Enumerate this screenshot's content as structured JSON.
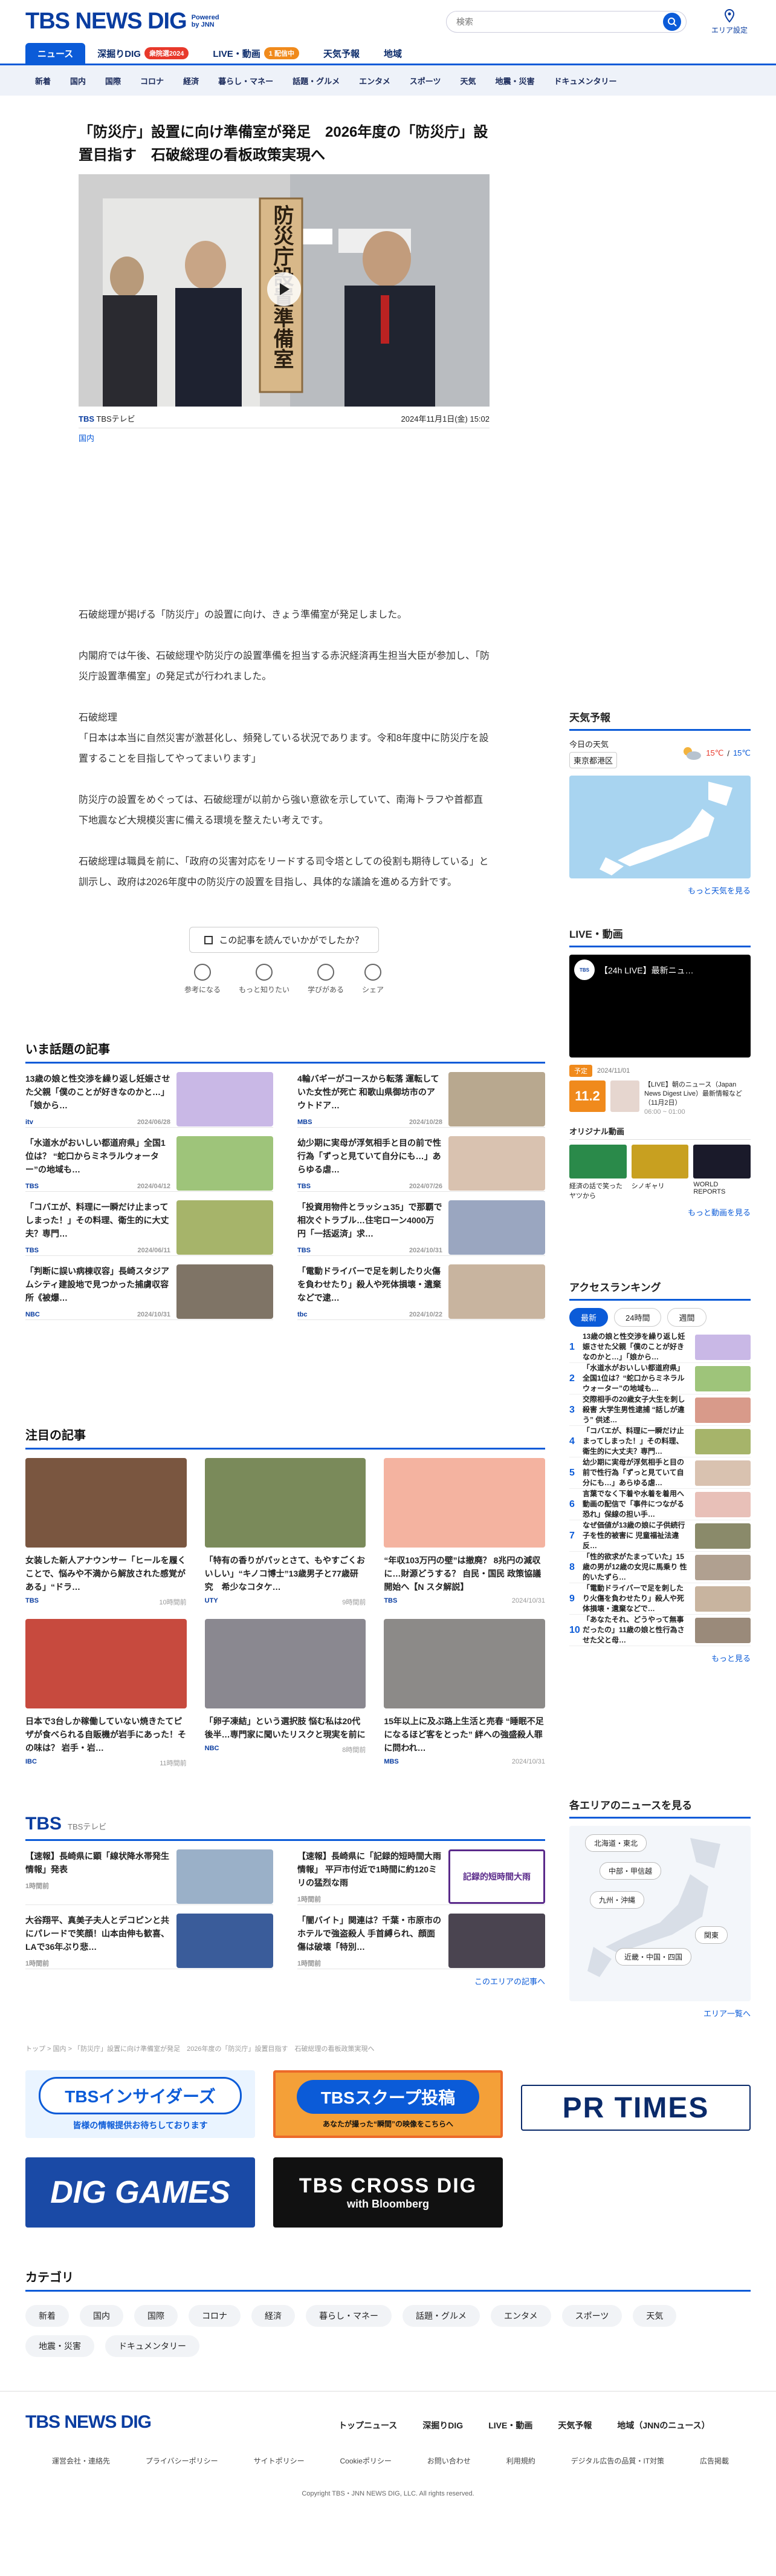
{
  "header": {
    "logo": "TBS NEWS DIG",
    "powered": "Powered by JNN",
    "search_placeholder": "検索",
    "area_label": "エリア設定"
  },
  "nav_main": [
    {
      "label": "ニュース"
    },
    {
      "label": "深掘りDIG",
      "badge": "衆院選2024",
      "badge_color": "#e8392b"
    },
    {
      "label": "LIVE・動画",
      "badge": "1 配信中",
      "badge_color": "#f08a1c"
    },
    {
      "label": "天気予報"
    },
    {
      "label": "地域"
    }
  ],
  "nav_sub": [
    "新着",
    "国内",
    "国際",
    "コロナ",
    "経済",
    "暮らし・マネー",
    "話題・グルメ",
    "エンタメ",
    "スポーツ",
    "天気",
    "地震・災害",
    "ドキュメンタリー"
  ],
  "article": {
    "title": "「防災庁」設置に向け準備室が発足　2026年度の「防災庁」設置目指す　石破総理の看板政策実現へ",
    "source": "TBSテレビ",
    "datetime": "2024年11月1日(金) 15:02",
    "category": "国内",
    "sign_text": "防災庁設置準備室",
    "body": [
      "石破総理が掲げる「防災庁」の設置に向け、きょう準備室が発足しました。",
      "内閣府では午後、石破総理や防災庁の設置準備を担当する赤沢経済再生担当大臣が参加し、「防災庁設置準備室」の発足式が行われました。",
      "石破総理\n「日本は本当に自然災害が激甚化し、頻発している状況であります。令和8年度中に防災庁を設置することを目指してやってまいります」",
      "防災庁の設置をめぐっては、石破総理が以前から強い意欲を示していて、南海トラフや首都直下地震など大規模災害に備える環境を整えたい考えです。",
      "石破総理は職員を前に、「政府の災害対応をリードする司令塔としての役割も期待している」と訓示し、政府は2026年度中の防災庁の設置を目指し、具体的な議論を進める方針です。"
    ]
  },
  "feedback": {
    "question": "この記事を読んでいかがでしたか？",
    "reactions": [
      "参考になる",
      "もっと知りたい",
      "学びがある",
      "シェア"
    ]
  },
  "trending": {
    "title": "いま話題の記事",
    "items": [
      {
        "text": "13歳の娘と性交渉を繰り返し妊娠させた父親「僕のことが好きなのかと…」「娘から…",
        "src": "itv",
        "date": "2024/06/28",
        "color": "#c9b8e6"
      },
      {
        "text": "4輪バギーがコースから転落 運転していた女性が死亡 和歌山県御坊市のアウトドア…",
        "src": "MBS",
        "date": "2024/10/28",
        "color": "#b8a88f"
      },
      {
        "text": "「水道水がおいしい都道府県」全国1位は？ “蛇口からミネラルウォーター”の地域も…",
        "src": "TBS",
        "date": "2024/04/12",
        "color": "#9ec47a"
      },
      {
        "text": "幼少期に実母が浮気相手と目の前で性行為「ずっと見ていて自分にも…」あらゆる虐…",
        "src": "TBS",
        "date": "2024/07/26",
        "color": "#d9c2b0"
      },
      {
        "text": "「コバエが、料理に一瞬だけ止まってしまった！」その料理、衛生的に大丈夫？専門…",
        "src": "TBS",
        "date": "2024/06/11",
        "color": "#a6b46a"
      },
      {
        "text": "「投資用物件とラッシュ35」で那覇で相次ぐトラブル…住宅ローン4000万円「一括返済」求…",
        "src": "TBS",
        "date": "2024/10/31",
        "color": "#9aa6c0"
      },
      {
        "text": "「判断に誤い病棟収容」長崎スタジアムシティ建設地で見つかった捕虜収容所《被爆…",
        "src": "NBC",
        "date": "2024/10/31",
        "color": "#7f7466"
      },
      {
        "text": "「電動ドライバーで足を刺したり火傷を負わせたり」殺人や死体損壊・遺棄などで逮…",
        "src": "tbc",
        "date": "2024/10/22",
        "color": "#c8b49f"
      }
    ]
  },
  "featured": {
    "title": "注目の記事",
    "items": [
      {
        "text": "女装した新人アナウンサー「ヒールを履くことで、悩みや不満から解放された感覚がある」“ドラ…",
        "src": "TBS",
        "date": "10時間前",
        "color": "#7a5640"
      },
      {
        "text": "「特有の香りがパッとさて、もやすごくおいしい」“キノコ博士”13歳男子と77歳研究　希少なコタケ…",
        "src": "UTY",
        "date": "9時間前",
        "color": "#7a8a5a"
      },
      {
        "text": "“年収103万円の壁”は撤廃？ 8兆円の減収に…財源どうする？ 自民・国民 政策協議開始へ【N スタ解説】",
        "src": "TBS",
        "date": "2024/10/31",
        "color": "#f4b3a0"
      },
      {
        "text": "日本で3台しか稼働していない焼きたてピザが食べられる自販機が岩手にあった！その味は？ 岩手・岩…",
        "src": "IBC",
        "date": "11時間前",
        "color": "#c74a3e"
      },
      {
        "text": "「卵子凍結」という選択肢 悩む私は20代後半…専門家に聞いたリスクと現実を前に",
        "src": "NBC",
        "date": "8時間前",
        "color": "#8a8890"
      },
      {
        "text": "15年以上に及ぶ路上生活と売春 “睡眠不足になるほど客をとった” 絆への強盛殺人罪に問われ…",
        "src": "MBS",
        "date": "2024/10/31",
        "color": "#8c8a88"
      }
    ]
  },
  "tbs": {
    "title": "TBS",
    "subtitle": "TBSテレビ",
    "items": [
      {
        "text": "【速報】長崎県に顕「線状降水帯発生情報」発表",
        "date": "1時間前",
        "color": "#9ab0c8"
      },
      {
        "text": "【速報】長崎県に「記録的短時間大雨情報」 平戸市付近で1時間に約120ミリの猛烈な雨",
        "date": "1時間前",
        "color": "#ffffff",
        "label": "記録的短時間大雨"
      },
      {
        "text": "大谷翔平、真美子夫人とデコピンと共にパレードで笑顔！山本由伸も歓喜、LAで36年ぶり悲…",
        "date": "1時間前",
        "color": "#3a5c9a"
      },
      {
        "text": "「闇バイト」関連は？千葉・市原市のホテルで強盗殺人 手首縛られ、顔面傷は破壊「特別…",
        "date": "1時間前",
        "color": "#4a4450"
      }
    ],
    "more": "このエリアの記事へ"
  },
  "breadcrumb": "トップ > 国内 > 「防災庁」設置に向け準備室が発足　2026年度の「防災庁」設置目指す　石破総理の看板政策実現へ",
  "banners": {
    "insiders": "TBSインサイダーズ",
    "insiders_sub": "皆様の情報提供お待ちしております",
    "scoop": "TBSスクープ投稿",
    "scoop_sub": "あなたが撮った“瞬間”の映像をこちらへ",
    "prtimes": "PR TIMES",
    "games": "DIG GAMES",
    "crossdig": "TBS CROSS DIG",
    "crossdig_sub": "with Bloomberg"
  },
  "categories": {
    "title": "カテゴリ",
    "items": [
      "新着",
      "国内",
      "国際",
      "コロナ",
      "経済",
      "暮らし・マネー",
      "話題・グルメ",
      "エンタメ",
      "スポーツ",
      "天気",
      "地震・災害",
      "ドキュメンタリー"
    ]
  },
  "sidebar": {
    "weather": {
      "title": "天気予報",
      "location": "東京都港区",
      "date": "今日の天気",
      "temp_high": "15℃",
      "temp_low": "15℃",
      "more": "もっと天気を見る"
    },
    "live": {
      "title": "LIVE・動画",
      "video_title": "【24h LIVE】最新ニュ…",
      "channel": "TBS NEWS DIG",
      "schedule_label": "予定",
      "date": "2024/11/01",
      "date_big": "11.2",
      "show_title": "【LIVE】朝のニュース（Japan News Digest Live）最新情報など（11月2日）",
      "time": "06:00 ~ 01:00",
      "original": "オリジナル動画",
      "videos": [
        "経済の話で笑ったヤツから",
        "シノギャリ",
        "WORLD REPORTS"
      ],
      "more": "もっと動画を見る"
    },
    "ranking": {
      "title": "アクセスランキング",
      "tabs": [
        "最新",
        "24時間",
        "週間"
      ],
      "items": [
        "13歳の娘と性交渉を繰り返し妊娠させた父親「僕のことが好きなのかと…」「娘から…",
        "「水道水がおいしい都道府県」全国1位は？“蛇口からミネラルウォーター”の地域も…",
        "交際相手の20歳女子大生を刺し殺害 大学生男性逮捕 “話しが違う” 供述…",
        "「コバエが、料理に一瞬だけ止まってしまった！」その料理、衛生的に大丈夫？専門…",
        "幼少期に実母が浮気相手と目の前で性行為「ずっと見ていて自分にも…」あらゆる虐…",
        "言葉でなく下着や水着を着用へ 動画の配信で「事件につながる恐れ」保線の担い手…",
        "なぜ価値が13歳の娘に子供続行 子を性的被害に 児童福祉法違反…",
        "「性的欲求がたまっていた」15歳の男が12歳の女児に馬乗り 性的いたずら…",
        "「電動ドライバーで足を刺したり火傷を負わせたり」殺人や死体損壊・遺棄などで…",
        "「あなたそれ、どうやって無事だったの」11歳の娘と性行為させた父と母…"
      ],
      "more": "もっと見る"
    },
    "areas": {
      "title": "各エリアのニュースを見る",
      "regions": [
        "北海道・東北",
        "中部・甲信越",
        "九州・沖縄",
        "関東",
        "近畿・中国・四国"
      ],
      "more": "エリア一覧へ"
    }
  },
  "footer": {
    "logo": "TBS NEWS DIG",
    "nav": [
      "トップニュース",
      "深掘りDIG",
      "LIVE・動画",
      "天気予報",
      "地域（JNNのニュース）"
    ],
    "links": [
      "運営会社・連絡先",
      "プライバシーポリシー",
      "サイトポリシー",
      "Cookieポリシー",
      "お問い合わせ",
      "利用規約",
      "デジタル広告の品質・IT対策",
      "広告掲載"
    ],
    "copyright": "Copyright TBS・JNN NEWS DIG, LLC. All rights reserved."
  }
}
